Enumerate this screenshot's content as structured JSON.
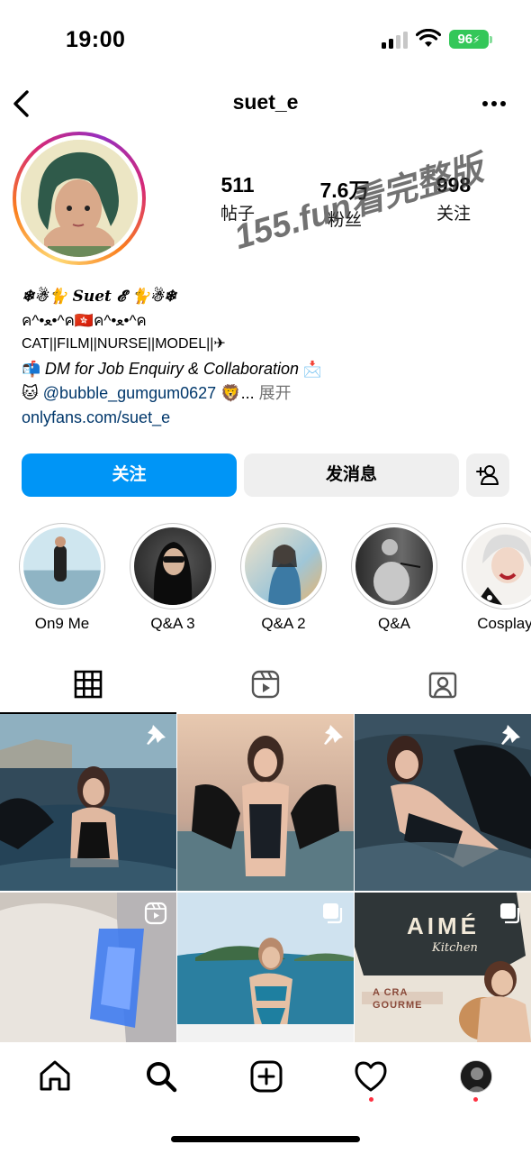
{
  "status_bar": {
    "time": "19:00",
    "battery": "96"
  },
  "header": {
    "username": "suet_e"
  },
  "stats": [
    {
      "value": "511",
      "label": "帖子"
    },
    {
      "value": "7.6万",
      "label": "粉丝"
    },
    {
      "value": "998",
      "label": "关注"
    }
  ],
  "watermark": "155.fun看完整版",
  "bio": {
    "name": "❄☃🐈 𝑺𝒖𝒆𝒕 𝓔 🐈☃❄",
    "line1": "ค^•ﻌ•^ค🇭🇰ค^•ﻌ•^ค",
    "line2": "CAT||FILM||NURSE||MODEL||✈",
    "line3_icon": "📬",
    "line3": "DM for Job Enquiry & Collaboration",
    "line3_end": "📩",
    "line4_icon": "🐱",
    "line4_mention": "@bubble_gumgum0627",
    "line4_end": "🦁...",
    "line4_more": "展开",
    "link": "onlyfans.com/suet_e"
  },
  "buttons": {
    "follow": "关注",
    "message": "发消息"
  },
  "highlights": [
    {
      "label": "On9 Me"
    },
    {
      "label": "Q&A 3"
    },
    {
      "label": "Q&A 2"
    },
    {
      "label": "Q&A"
    },
    {
      "label": "Cosplay"
    }
  ],
  "tabs": [
    "grid-icon",
    "reels-icon",
    "tagged-icon"
  ],
  "grid_posts": [
    {
      "badge": "pin-icon"
    },
    {
      "badge": "pin-icon"
    },
    {
      "badge": "pin-icon"
    },
    {
      "badge": "reel-icon"
    },
    {
      "badge": "carousel-icon"
    },
    {
      "badge": "carousel-icon",
      "overlay_title": "AIMÉ",
      "overlay_sub": "Kitchen",
      "overlay_caption": "A CRA\nGOURME"
    }
  ],
  "nav": [
    "home-icon",
    "search-icon",
    "create-icon",
    "heart-icon",
    "profile-avatar"
  ],
  "colors": {
    "accent": "#0095f6",
    "notification_dot": "#ff3040",
    "battery": "#34c759"
  }
}
